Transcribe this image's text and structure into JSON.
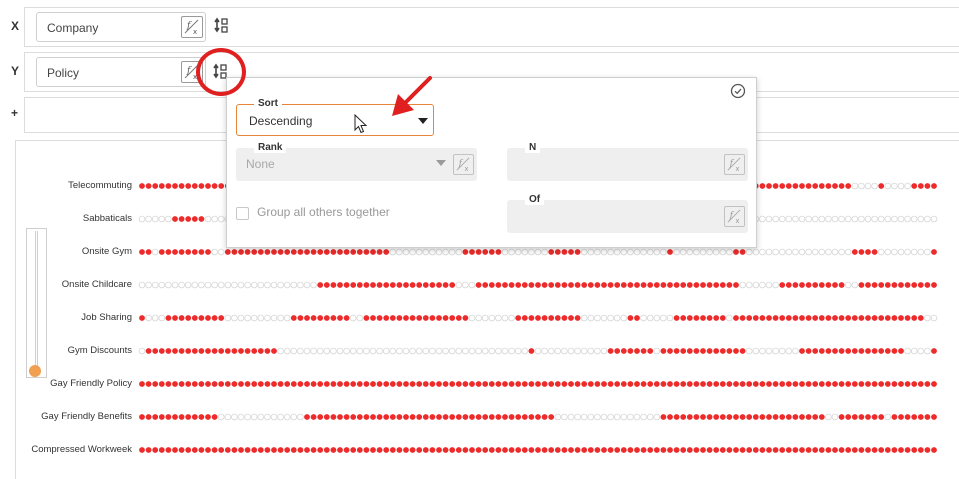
{
  "axes": {
    "x": {
      "letter": "X",
      "field": "Company"
    },
    "y": {
      "letter": "Y",
      "field": "Policy"
    },
    "add": "+"
  },
  "chart_data": {
    "type": "scatter",
    "rows": [
      "Telecommuting",
      "Sabbaticals",
      "Onsite Gym",
      "Onsite Childcare",
      "Job Sharing",
      "Gym Discounts",
      "Gay Friendly Policy",
      "Gay Friendly Benefits",
      "Compressed Workweek"
    ],
    "marker_colors": {
      "filled": "#ee2b2b",
      "empty": "#ffffff"
    }
  },
  "sort_popover": {
    "sort_label": "Sort",
    "sort_value": "Descending",
    "rank_label": "Rank",
    "rank_value": "None",
    "n_label": "N",
    "of_label": "Of",
    "group_label": "Group all others together"
  },
  "colors": {
    "accent": "#e8843a",
    "annotation": "#e02020",
    "slider": "#f0a050"
  },
  "icons": [
    "fx-icon",
    "sort-icon",
    "check-circle-icon",
    "mouse-cursor-icon",
    "annotation-arrow"
  ]
}
